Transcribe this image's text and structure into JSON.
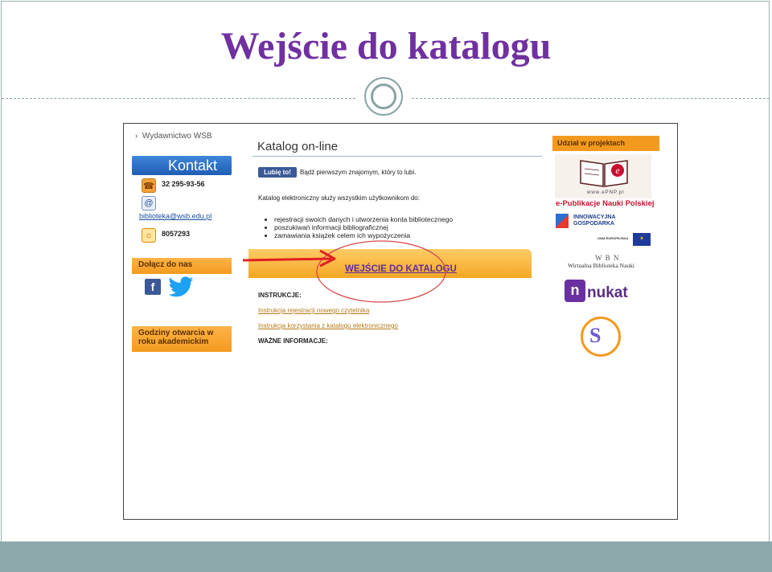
{
  "slide": {
    "title": "Wejście do katalogu",
    "colors": {
      "title": "#7030a0",
      "accent": "#8ca8aa",
      "annotation": "#e02020"
    }
  },
  "screenshot": {
    "breadcrumb": "Wydawnictwo WSB",
    "left": {
      "contact_header": "Kontakt",
      "phone": "32 295-93-56",
      "email": "biblioteka@wsb.edu.pl",
      "number": "8057293",
      "join_header": "Dołącz do nas",
      "hours_header": "Godziny otwarcia w roku akademickim",
      "icons": [
        "phone-icon",
        "email-icon",
        "sun-icon",
        "facebook-icon",
        "twitter-icon"
      ]
    },
    "main": {
      "title": "Katalog on-line",
      "like_button": "Lubię to!",
      "like_text": "Bądź pierwszym znajomym, który to lubi.",
      "intro": "Katalog elektroniczny służy wszystkim użytkownikom do:",
      "bullets": [
        "rejestracji swoich danych i utworzenia konta bibliotecznego",
        "poszukiwań informacji bibliograficznej",
        "zamawiania książek celem ich wypożyczenia"
      ],
      "catalog_link": "WEJŚCIE DO KATALOGU",
      "instructions_header": "INSTRUKCJE:",
      "instruction_links": [
        "Instrukcja rejestracji nowego czytelnika",
        "Instrukcja korzystania z katalogu elektronicznego"
      ],
      "important_header": "WAŻNE INFORMACJE:"
    },
    "right": {
      "header": "Udział w projektach",
      "epnp_url": "www.ePNP.pl",
      "epnp_caption": "e-Publikacje Nauki Polskiej",
      "innowacyjna_line1": "INNOWACYJNA",
      "innowacyjna_line2": "GOSPODARKA",
      "eu_text": "UNIA EUROPEJSKA",
      "wbn_title": "W B N",
      "wbn_caption": "Wirtualna Biblioteka Nauki",
      "nukat_text": "nukat",
      "logo_letter": "S"
    }
  }
}
